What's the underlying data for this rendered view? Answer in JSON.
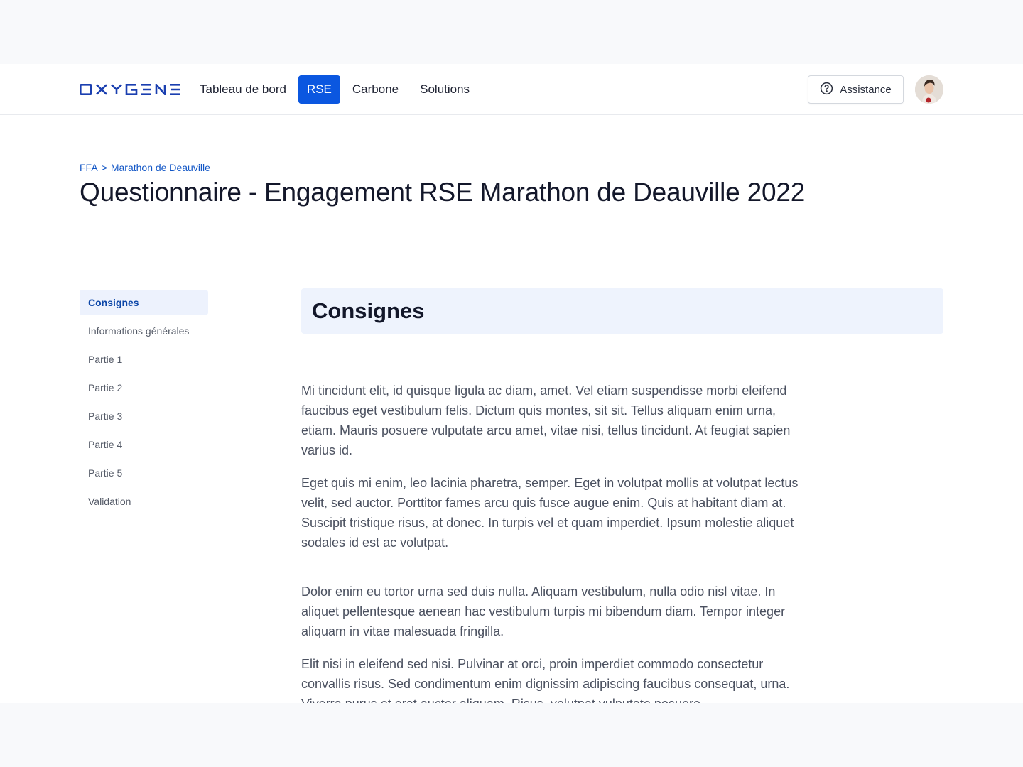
{
  "header": {
    "logo_text": "OXYGENE",
    "nav": [
      {
        "label": "Tableau de bord",
        "active": false
      },
      {
        "label": "RSE",
        "active": true
      },
      {
        "label": "Carbone",
        "active": false
      },
      {
        "label": "Solutions",
        "active": false
      }
    ],
    "assistance_label": "Assistance",
    "assistance_icon": "help-circle-icon",
    "avatar_icon": "user-avatar"
  },
  "breadcrumb": {
    "items": [
      "FFA",
      "Marathon de Deauville"
    ],
    "separator": ">"
  },
  "page_title": "Questionnaire - Engagement RSE Marathon de Deauville 2022",
  "sidebar": {
    "items": [
      {
        "label": "Consignes",
        "active": true
      },
      {
        "label": "Informations générales",
        "active": false
      },
      {
        "label": "Partie 1",
        "active": false
      },
      {
        "label": "Partie 2",
        "active": false
      },
      {
        "label": "Partie 3",
        "active": false
      },
      {
        "label": "Partie 4",
        "active": false
      },
      {
        "label": "Partie 5",
        "active": false
      },
      {
        "label": "Validation",
        "active": false
      }
    ]
  },
  "section": {
    "title": "Consignes",
    "paragraphs": [
      "Mi tincidunt elit, id quisque ligula ac diam, amet. Vel etiam suspendisse morbi eleifend faucibus eget vestibulum felis. Dictum quis montes, sit sit. Tellus aliquam enim urna, etiam. Mauris posuere vulputate arcu amet, vitae nisi, tellus tincidunt. At feugiat sapien varius id.",
      "Eget quis mi enim, leo lacinia pharetra, semper. Eget in volutpat mollis at volutpat lectus velit, sed auctor. Porttitor fames arcu quis fusce augue enim. Quis at habitant diam at. Suscipit tristique risus, at donec. In turpis vel et quam imperdiet. Ipsum molestie aliquet sodales id est ac volutpat.",
      "Dolor enim eu tortor urna sed duis nulla. Aliquam vestibulum, nulla odio nisl vitae. In aliquet pellentesque aenean hac vestibulum turpis mi bibendum diam. Tempor integer aliquam in vitae malesuada fringilla.",
      "Elit nisi in eleifend sed nisi. Pulvinar at orci, proin imperdiet commodo consectetur convallis risus. Sed condimentum enim dignissim adipiscing faucibus consequat, urna. Viverra purus et erat auctor aliquam. Risus, volutpat vulputate posuere"
    ]
  },
  "colors": {
    "brand": "#0b57e0",
    "link": "#1357c6",
    "section_bg": "#eef3fd",
    "sidebar_active_bg": "#edf2fd",
    "logo": "#1a3fb0"
  }
}
